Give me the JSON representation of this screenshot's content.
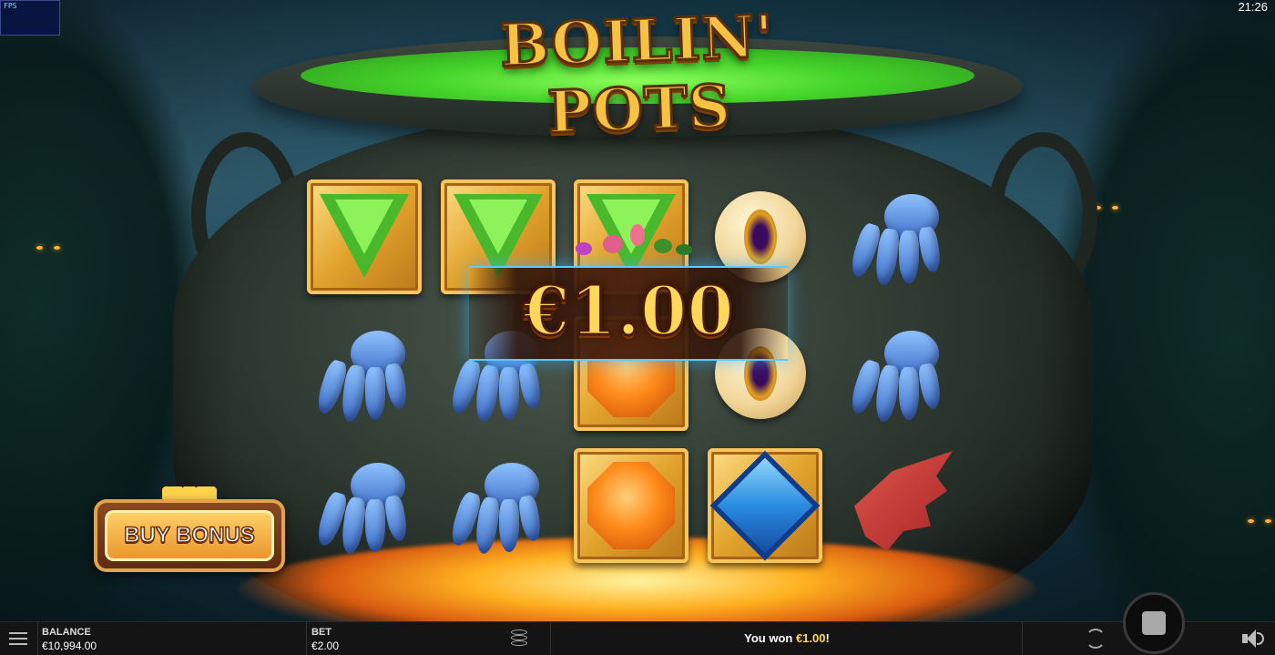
{
  "game": {
    "title": "BOILIN' POTS",
    "win_display": "€1.00"
  },
  "reels": [
    [
      "green-gem",
      "blue-claw",
      "blue-claw"
    ],
    [
      "green-gem",
      "blue-claw",
      "blue-claw"
    ],
    [
      "green-gem",
      "orange-gem",
      "orange-gem"
    ],
    [
      "golden-eye",
      "golden-eye",
      "blue-gem"
    ],
    [
      "blue-claw",
      "blue-claw",
      "red-wing"
    ]
  ],
  "buy_bonus": {
    "label": "BUY BONUS"
  },
  "status": {
    "fps_label": "FPS",
    "clock": "21:26"
  },
  "bottom_bar": {
    "balance_label": "BALANCE",
    "balance_value": "€10,994.00",
    "bet_label": "BET",
    "bet_value": "€2.00",
    "win_prefix": "You won ",
    "win_amount": "€1.00",
    "win_suffix": "!"
  },
  "colors": {
    "accent": "#ffd84a",
    "brew": "#45d42a",
    "bar_bg": "#141414"
  },
  "icons": [
    "menu-icon",
    "coins-icon",
    "refresh-icon",
    "stop-icon",
    "sound-icon"
  ]
}
